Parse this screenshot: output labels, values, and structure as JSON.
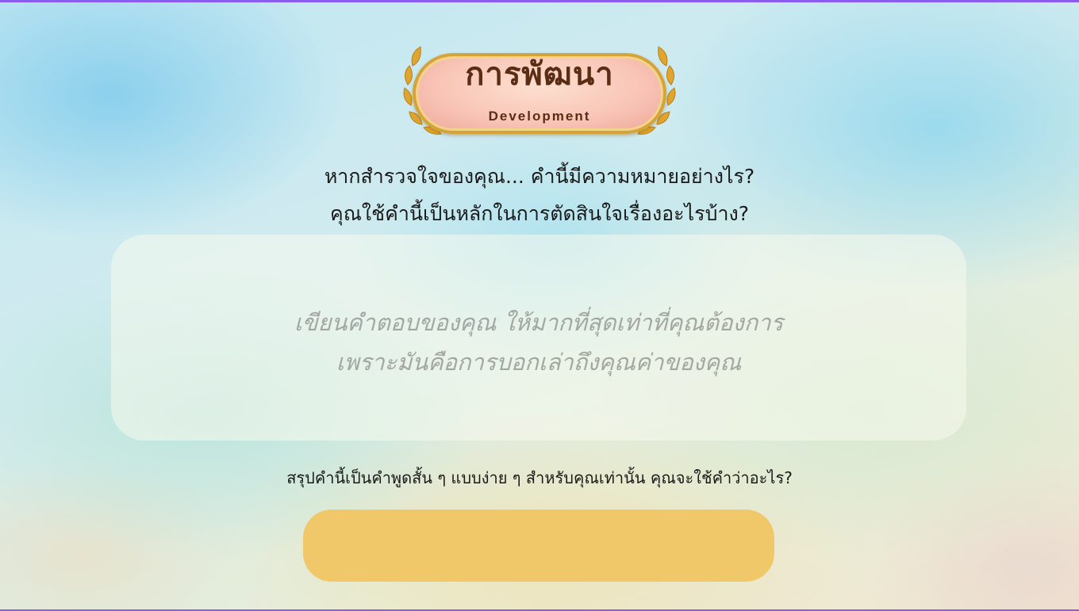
{
  "badge": {
    "title": "การพัฒนา",
    "subtitle": "Development"
  },
  "questions": [
    "หากสำรวจใจของคุณ... คำนี้มีความหมายอย่างไร?",
    "คุณใช้คำนี้เป็นหลักในการตัดสินใจเรื่องอะไรบ้าง?"
  ],
  "answer_box": {
    "placeholder_lines": [
      "เขียนคำตอบของคุณ  ให้มากที่สุดเท่าที่คุณต้องการ",
      "เพราะมันคือการบอกเล่าถึงคุณค่าของคุณ"
    ]
  },
  "summary": {
    "question": "สรุปคำนี้เป็นคำพูดสั้น ๆ แบบง่าย ๆ สำหรับคุณเท่านั้น คุณจะใช้คำว่าอะไร?",
    "value": ""
  },
  "colors": {
    "summary_field": "#f0c86a",
    "badge_gold": "#d4a33a",
    "frame": "#8a5cf0"
  }
}
